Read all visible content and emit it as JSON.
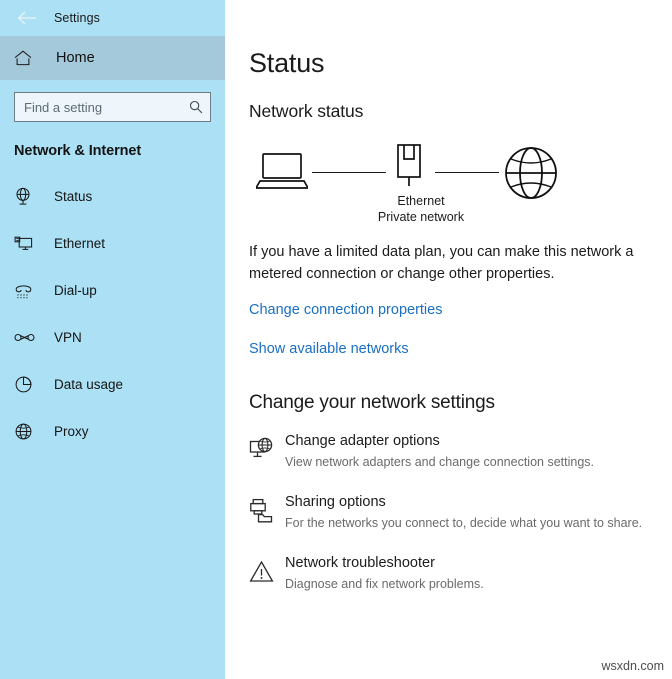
{
  "window": {
    "app_title": "Settings",
    "back_icon": "back-arrow-icon"
  },
  "sidebar": {
    "home": {
      "label": "Home",
      "icon": "home-icon"
    },
    "search": {
      "value": "",
      "placeholder": "Find a setting",
      "icon": "search-icon"
    },
    "category": "Network & Internet",
    "items": [
      {
        "label": "Status",
        "icon": "globe-status-icon",
        "selected": true
      },
      {
        "label": "Ethernet",
        "icon": "ethernet-monitor-icon",
        "selected": false
      },
      {
        "label": "Dial-up",
        "icon": "telephone-icon",
        "selected": false
      },
      {
        "label": "VPN",
        "icon": "vpn-link-icon",
        "selected": false
      },
      {
        "label": "Data usage",
        "icon": "pie-chart-icon",
        "selected": false
      },
      {
        "label": "Proxy",
        "icon": "globe-icon",
        "selected": false
      }
    ]
  },
  "main": {
    "page_title": "Status",
    "network_status_heading": "Network status",
    "diagram": {
      "device_icon": "laptop-icon",
      "adapter_icon": "ethernet-port-icon",
      "internet_icon": "globe-icon",
      "adapter_name": "Ethernet",
      "network_type": "Private network"
    },
    "description": "If you have a limited data plan, you can make this network a metered connection or change other properties.",
    "links": [
      {
        "label": "Change connection properties"
      },
      {
        "label": "Show available networks"
      }
    ],
    "change_settings_heading": "Change your network settings",
    "options": [
      {
        "title": "Change adapter options",
        "desc": "View network adapters and change connection settings.",
        "icon": "adapter-globe-icon"
      },
      {
        "title": "Sharing options",
        "desc": "For the networks you connect to, decide what you want to share.",
        "icon": "sharing-printer-folder-icon"
      },
      {
        "title": "Network troubleshooter",
        "desc": "Diagnose and fix network problems.",
        "icon": "warning-triangle-icon"
      }
    ]
  },
  "watermark": "wsxdn.com",
  "colors": {
    "sidebar_bg": "#ace0f5",
    "home_band": "#a4c9da",
    "link": "#1a6fc4",
    "text": "#1b1b1b",
    "muted_text": "#6a6a6a"
  }
}
